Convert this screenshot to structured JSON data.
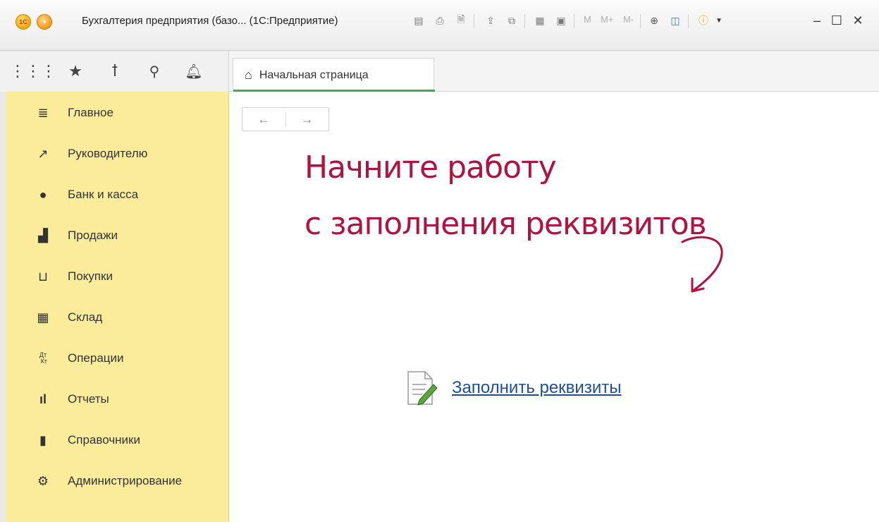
{
  "window": {
    "title": "Бухгалтерия предприятия (базо... (1С:Предприятие)",
    "logo_text": "1С",
    "toolbar_icons": [
      "save-icon",
      "print-icon",
      "preview-icon",
      "upload-icon",
      "copy-icon",
      "calculator-icon",
      "calendar-icon"
    ],
    "memory_buttons": [
      "M",
      "M+",
      "M-"
    ],
    "controls": {
      "minimize": "–",
      "maximize": "☐",
      "close": "✕"
    }
  },
  "sections_bar": {
    "icons": [
      "apps-grid-icon",
      "favorites-star-icon",
      "history-icon",
      "search-icon",
      "notifications-bell-icon"
    ]
  },
  "tabs": [
    {
      "label": "Начальная страница",
      "icon": "home-icon",
      "active": true
    }
  ],
  "sidebar": {
    "items": [
      {
        "label": "Главное",
        "icon": "list-icon"
      },
      {
        "label": "Руководителю",
        "icon": "trend-icon"
      },
      {
        "label": "Банк и касса",
        "icon": "coin-icon"
      },
      {
        "label": "Продажи",
        "icon": "bag-icon"
      },
      {
        "label": "Покупки",
        "icon": "cart-icon"
      },
      {
        "label": "Склад",
        "icon": "warehouse-icon"
      },
      {
        "label": "Операции",
        "icon": "debit-credit-icon",
        "icon_text": "Дт\nКт"
      },
      {
        "label": "Отчеты",
        "icon": "bar-chart-icon"
      },
      {
        "label": "Справочники",
        "icon": "books-icon"
      },
      {
        "label": "Администрирование",
        "icon": "gear-icon"
      }
    ]
  },
  "main": {
    "nav": {
      "back": "←",
      "forward": "→"
    },
    "hint_line1": "Начните работу",
    "hint_line2": "с заполнения реквизитов",
    "fill_link": "Заполнить реквизиты"
  },
  "colors": {
    "sidebar_bg": "#fbec9c",
    "hint_text": "#b2123f",
    "link": "#1d4fa0",
    "tab_underline": "#4aa35a"
  }
}
